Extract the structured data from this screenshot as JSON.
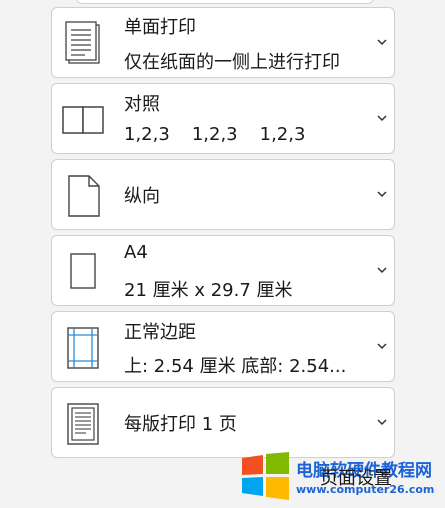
{
  "settings": [
    {
      "title": "单面打印",
      "subtitle": "仅在纸面的一侧上进行打印",
      "icon": "single-sided-page-icon"
    },
    {
      "title": "对照",
      "subtitle_parts": [
        "1,2,3",
        "1,2,3",
        "1,2,3"
      ],
      "icon": "collated-pages-icon"
    },
    {
      "title": "纵向",
      "icon": "portrait-page-icon"
    },
    {
      "title": "A4",
      "subtitle": "21 厘米 x 29.7 厘米",
      "icon": "paper-size-icon"
    },
    {
      "title": "正常边距",
      "subtitle": "上: 2.54 厘米 底部: 2.54...",
      "icon": "margins-icon"
    },
    {
      "title": "每版打印 1 页",
      "icon": "pages-per-sheet-icon"
    }
  ],
  "overlay": {
    "brand_text": "电脑软硬件教程网",
    "brand_url": "www.computer26.com",
    "page_setup_label": "页面设置"
  },
  "colors": {
    "background": "#f3f3f3",
    "card": "#ffffff",
    "border": "#d0d0d0",
    "margin_guides": "#2e8bd8",
    "brand_blue": "#1d63d6",
    "win_red": "#f25022",
    "win_green": "#7fba00",
    "win_blue": "#00a4ef",
    "win_yellow": "#ffb900"
  }
}
